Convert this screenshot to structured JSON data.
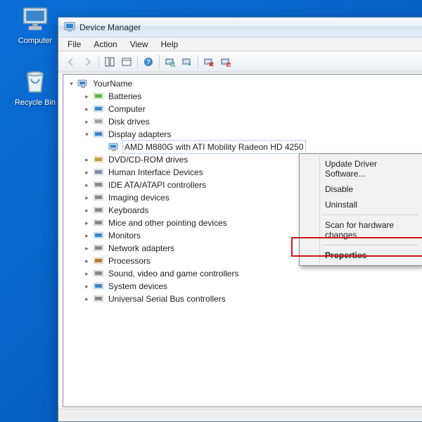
{
  "desktop": {
    "computer_label": "Computer",
    "recycle_label": "Recycle Bin"
  },
  "window": {
    "title": "Device Manager"
  },
  "menubar": [
    "File",
    "Action",
    "View",
    "Help"
  ],
  "tree": {
    "root": "YourName",
    "categories": [
      {
        "label": "Batteries",
        "expanded": false
      },
      {
        "label": "Computer",
        "expanded": false
      },
      {
        "label": "Disk drives",
        "expanded": false
      },
      {
        "label": "Display adapters",
        "expanded": true,
        "children": [
          {
            "label": "AMD M880G with ATI Mobility Radeon HD 4250",
            "selected": true
          }
        ]
      },
      {
        "label": "DVD/CD-ROM drives",
        "expanded": false
      },
      {
        "label": "Human Interface Devices",
        "expanded": false
      },
      {
        "label": "IDE ATA/ATAPI controllers",
        "expanded": false
      },
      {
        "label": "Imaging devices",
        "expanded": false
      },
      {
        "label": "Keyboards",
        "expanded": false
      },
      {
        "label": "Mice and other pointing devices",
        "expanded": false
      },
      {
        "label": "Monitors",
        "expanded": false
      },
      {
        "label": "Network adapters",
        "expanded": false
      },
      {
        "label": "Processors",
        "expanded": false
      },
      {
        "label": "Sound, video and game controllers",
        "expanded": false
      },
      {
        "label": "System devices",
        "expanded": false
      },
      {
        "label": "Universal Serial Bus controllers",
        "expanded": false
      }
    ]
  },
  "context_menu": {
    "items": [
      "Update Driver Software...",
      "Disable",
      "Uninstall"
    ],
    "items2": [
      "Scan for hardware changes"
    ],
    "items3": [
      "Properties"
    ],
    "highlighted": "Properties"
  },
  "statusbar": ""
}
